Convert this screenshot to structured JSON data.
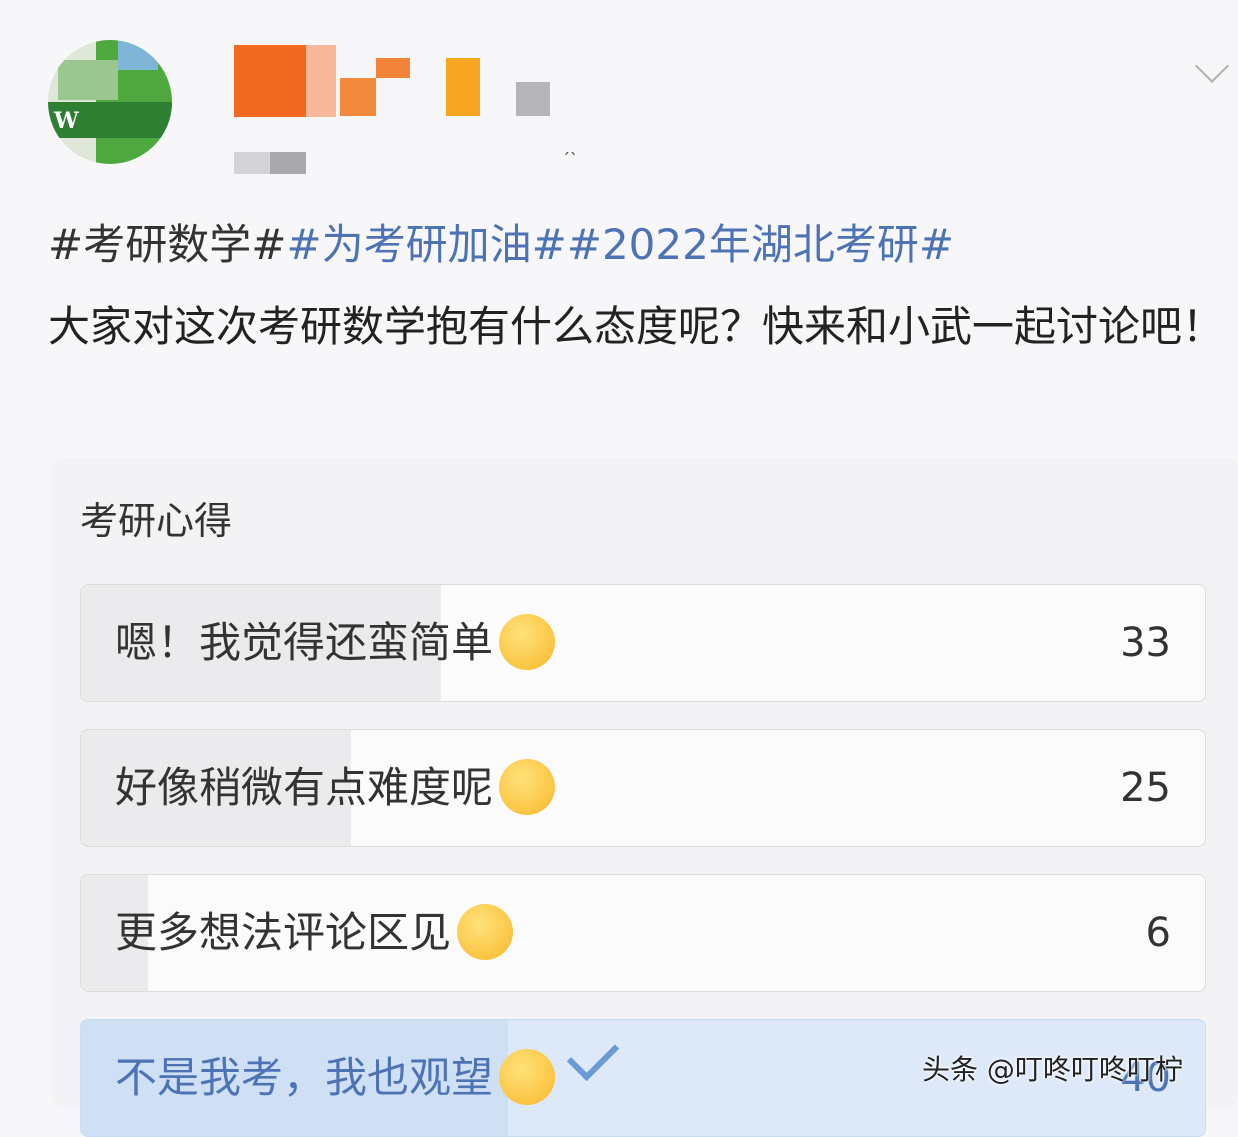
{
  "post": {
    "tags": [
      {
        "text": "#考研数学#",
        "color": "#333333"
      },
      {
        "text": "#为考研加油##2022年湖北考研#",
        "color": "#4e73b5"
      }
    ],
    "body": "大家对这次考研数学抱有什么态度呢？快来和小武一起讨论吧！"
  },
  "poll": {
    "title": "考研心得",
    "options": [
      {
        "label": "嗯！我觉得还蛮简单",
        "emoji": "kiss-heart-emoji",
        "count": "33",
        "share": 0.32
      },
      {
        "label": "好像稍微有点难度呢",
        "emoji": "crying-emoji",
        "count": "25",
        "share": 0.24
      },
      {
        "label": "更多想法评论区见",
        "emoji": "zany-face-emoji",
        "count": "6",
        "share": 0.06
      },
      {
        "label": "不是我考，我也观望",
        "emoji": "moon-face-emoji",
        "count": "40",
        "share": 0.38,
        "selected": true
      }
    ]
  },
  "watermark": "头条 @叮咚叮咚叮柠",
  "colors": {
    "accent": "#4e73b5",
    "background": "#f7f7f9"
  }
}
